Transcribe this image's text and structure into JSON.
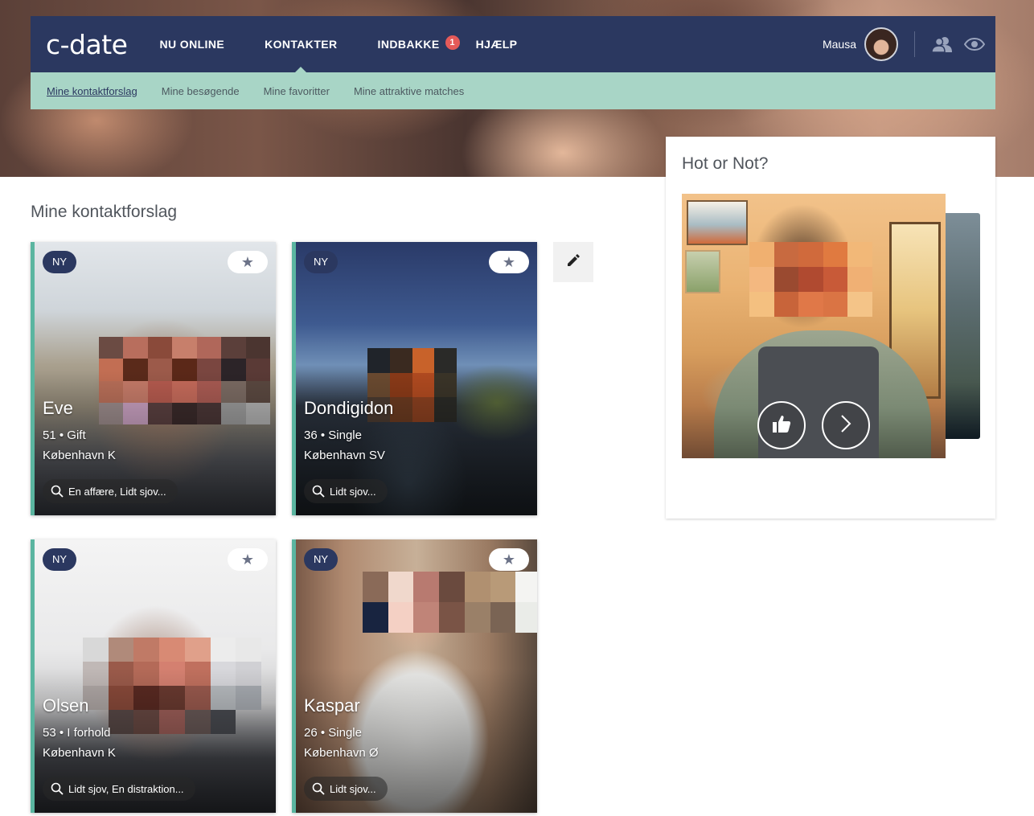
{
  "brand": {
    "logo_text": "c-date"
  },
  "nav": {
    "items": [
      {
        "label": "NU ONLINE"
      },
      {
        "label": "KONTAKTER"
      },
      {
        "label": "INDBAKKE"
      },
      {
        "label": "HJÆLP"
      }
    ],
    "inbox_badge": "1",
    "active_item": "KONTAKTER",
    "username": "Mausa",
    "icons": [
      "avatar",
      "contacts-icon",
      "eye-icon"
    ]
  },
  "subnav": {
    "items": [
      {
        "label": "Mine kontaktforslag"
      },
      {
        "label": "Mine besøgende"
      },
      {
        "label": "Mine favoritter"
      },
      {
        "label": "Mine attraktive matches"
      }
    ],
    "active_item": "Mine kontaktforslag"
  },
  "main": {
    "title": "Mine kontaktforslag",
    "cards": [
      {
        "badge": "NY",
        "name": "Eve",
        "meta": "51 • Gift",
        "city": "København K",
        "search": "En affære, Lidt sjov..."
      },
      {
        "badge": "NY",
        "name": "Dondigidon",
        "meta": "36 • Single",
        "city": "København SV",
        "search": "Lidt sjov..."
      },
      {
        "badge": "NY",
        "name": "Olsen",
        "meta": "53 • I forhold",
        "city": "København K",
        "search": "Lidt sjov, En distraktion..."
      },
      {
        "badge": "NY",
        "name": "Kaspar",
        "meta": "26 • Single",
        "city": "København Ø",
        "search": "Lidt sjov..."
      }
    ]
  },
  "hot_or_not": {
    "title": "Hot or Not?",
    "icons": [
      "thumbs-up-icon",
      "chevron-right-icon"
    ]
  },
  "colors": {
    "nav_bg": "#2b3860",
    "subnav_bg": "#a8d5c6",
    "badge": "#e55a59",
    "card_accent": "#5ab5a0"
  }
}
